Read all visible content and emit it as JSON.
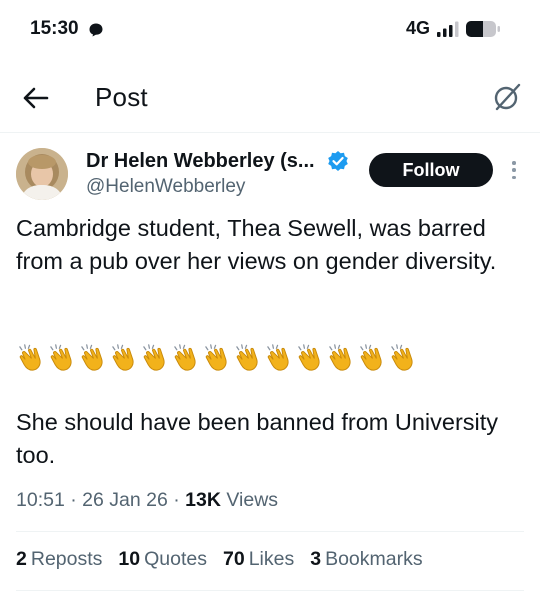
{
  "status_bar": {
    "time": "15:30",
    "network": "4G",
    "icons": [
      "do-not-disturb-icon",
      "signal-icon",
      "battery-icon"
    ]
  },
  "header": {
    "title": "Post",
    "back_icon": "arrow-left-icon",
    "grok_icon": "grok-icon"
  },
  "post": {
    "author_name": "Dr Helen Webberley (s...",
    "handle": "@HelenWebberley",
    "verified_icon": "verified-badge-icon",
    "follow_label": "Follow",
    "text_1": "Cambridge student, Thea Sewell, was barred from a pub over her views on gender diversity.",
    "emoji_count": 13,
    "emoji": "clapping-hands",
    "text_2": "She should have been banned from University too.",
    "time": "10:51",
    "date": "26 Jan 26",
    "separator": "·",
    "views_count": "13K",
    "views_label": "Views"
  },
  "stats": [
    {
      "count": "2",
      "label": "Reposts"
    },
    {
      "count": "10",
      "label": "Quotes"
    },
    {
      "count": "70",
      "label": "Likes"
    },
    {
      "count": "3",
      "label": "Bookmarks"
    }
  ],
  "colors": {
    "text": "#0f1419",
    "secondary": "#536471",
    "verified": "#1d9bf0",
    "follow_bg": "#0f1419",
    "divider": "#eff3f4"
  }
}
